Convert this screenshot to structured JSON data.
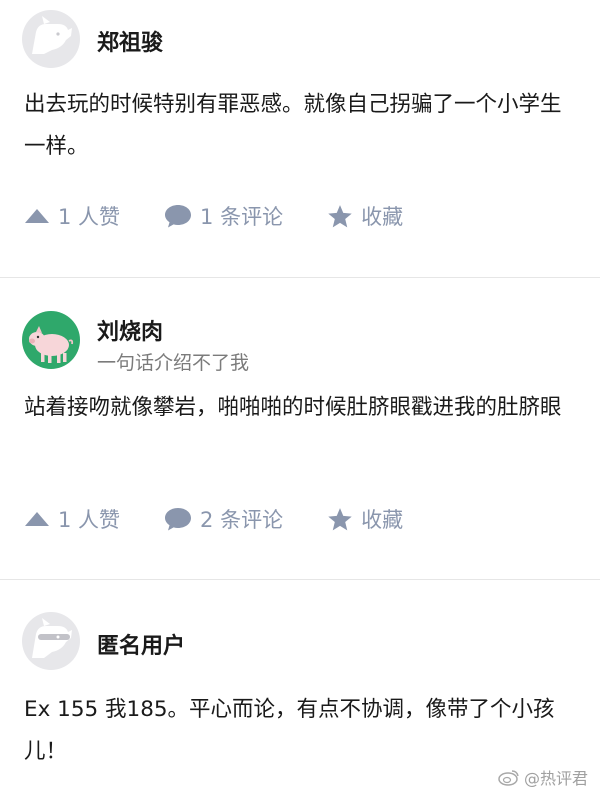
{
  "posts": [
    {
      "username": "郑祖骏",
      "bio": "",
      "avatar": "default-avatar",
      "content": "出去玩的时候特别有罪恶感。就像自己拐骗了一个小学生一样。",
      "likes_label": "1 人赞",
      "comments_label": "1 条评论",
      "favorite_label": "收藏"
    },
    {
      "username": "刘烧肉",
      "bio": "一句话介绍不了我",
      "avatar": "pig-avatar",
      "content": "站着接吻就像攀岩，啪啪啪的时候肚脐眼戳进我的肚脐眼",
      "likes_label": "1 人赞",
      "comments_label": "2 条评论",
      "favorite_label": "收藏"
    },
    {
      "username": "匿名用户",
      "bio": "",
      "avatar": "anonymous-avatar",
      "content": "Ex 155 我185。平心而论，有点不协调，像带了个小孩儿！",
      "likes_label": "",
      "comments_label": "",
      "favorite_label": ""
    }
  ],
  "icons": {
    "like": "upvote-triangle-icon",
    "comment": "comment-bubble-icon",
    "favorite": "star-icon"
  },
  "colors": {
    "action": "#8a96ad",
    "avatar_default": "#e7e7ea",
    "pig_avatar_bg": "#2fa86b"
  },
  "watermark": {
    "text": "@热评君",
    "icon": "weibo-icon"
  }
}
